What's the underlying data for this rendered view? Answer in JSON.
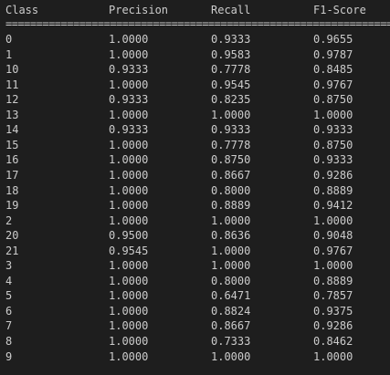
{
  "header": {
    "class": "Class",
    "precision": "Precision",
    "recall": "Recall",
    "f1": "F1-Score"
  },
  "separator": "====================================================================",
  "rows": [
    {
      "cls": "0",
      "p": "1.0000",
      "r": "0.9333",
      "f": "0.9655"
    },
    {
      "cls": "1",
      "p": "1.0000",
      "r": "0.9583",
      "f": "0.9787"
    },
    {
      "cls": "10",
      "p": "0.9333",
      "r": "0.7778",
      "f": "0.8485"
    },
    {
      "cls": "11",
      "p": "1.0000",
      "r": "0.9545",
      "f": "0.9767"
    },
    {
      "cls": "12",
      "p": "0.9333",
      "r": "0.8235",
      "f": "0.8750"
    },
    {
      "cls": "13",
      "p": "1.0000",
      "r": "1.0000",
      "f": "1.0000"
    },
    {
      "cls": "14",
      "p": "0.9333",
      "r": "0.9333",
      "f": "0.9333"
    },
    {
      "cls": "15",
      "p": "1.0000",
      "r": "0.7778",
      "f": "0.8750"
    },
    {
      "cls": "16",
      "p": "1.0000",
      "r": "0.8750",
      "f": "0.9333"
    },
    {
      "cls": "17",
      "p": "1.0000",
      "r": "0.8667",
      "f": "0.9286"
    },
    {
      "cls": "18",
      "p": "1.0000",
      "r": "0.8000",
      "f": "0.8889"
    },
    {
      "cls": "19",
      "p": "1.0000",
      "r": "0.8889",
      "f": "0.9412"
    },
    {
      "cls": "2",
      "p": "1.0000",
      "r": "1.0000",
      "f": "1.0000"
    },
    {
      "cls": "20",
      "p": "0.9500",
      "r": "0.8636",
      "f": "0.9048"
    },
    {
      "cls": "21",
      "p": "0.9545",
      "r": "1.0000",
      "f": "0.9767"
    },
    {
      "cls": "3",
      "p": "1.0000",
      "r": "1.0000",
      "f": "1.0000"
    },
    {
      "cls": "4",
      "p": "1.0000",
      "r": "0.8000",
      "f": "0.8889"
    },
    {
      "cls": "5",
      "p": "1.0000",
      "r": "0.6471",
      "f": "0.7857"
    },
    {
      "cls": "6",
      "p": "1.0000",
      "r": "0.8824",
      "f": "0.9375"
    },
    {
      "cls": "7",
      "p": "1.0000",
      "r": "0.8667",
      "f": "0.9286"
    },
    {
      "cls": "8",
      "p": "1.0000",
      "r": "0.7333",
      "f": "0.8462"
    },
    {
      "cls": "9",
      "p": "1.0000",
      "r": "1.0000",
      "f": "1.0000"
    }
  ],
  "colors": {
    "background": "#1e1e1e",
    "text": "#cccccc"
  }
}
